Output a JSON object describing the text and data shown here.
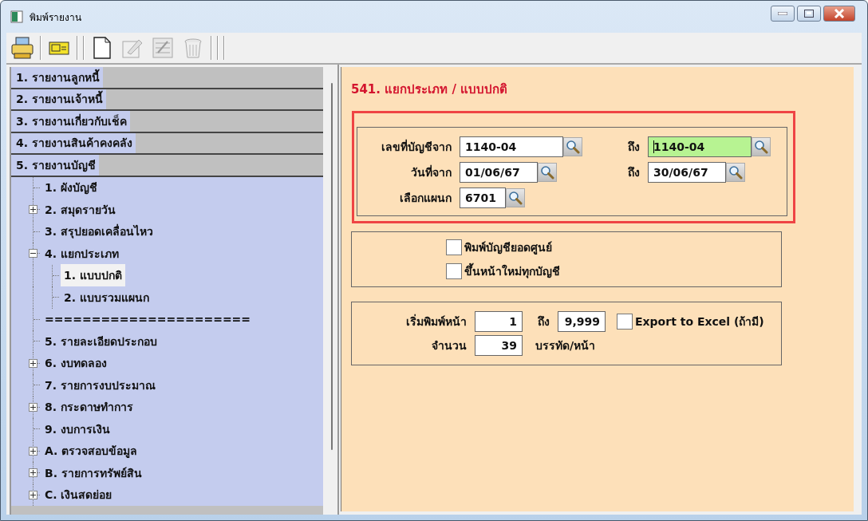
{
  "window": {
    "title": "พิมพ์รายงาน"
  },
  "toolbar": [
    {
      "kind": "printer",
      "disabled": false
    },
    {
      "kind": "card",
      "disabled": false
    },
    {
      "kind": "page",
      "disabled": false
    },
    {
      "kind": "edit",
      "disabled": true
    },
    {
      "kind": "form",
      "disabled": true
    },
    {
      "kind": "trash",
      "disabled": true
    }
  ],
  "sections": [
    {
      "label": "1. รายงานลูกหนี้"
    },
    {
      "label": "2. รายงานเจ้าหนี้"
    },
    {
      "label": "3. รายงานเกี่ยวกับเช็ค"
    },
    {
      "label": "4. รายงานสินค้าคงคลัง"
    },
    {
      "label": "5. รายงานบัญชี",
      "children": [
        {
          "label": "1. ผังบัญชี",
          "kind": "leaf",
          "selected": false
        },
        {
          "label": "2. สมุดรายวัน",
          "kind": "folder",
          "expanded": false,
          "selected": false
        },
        {
          "label": "3. สรุปยอดเคลื่อนไหว",
          "kind": "leaf",
          "selected": false
        },
        {
          "label": "4. แยกประเภท",
          "kind": "folder",
          "expanded": true,
          "selected": false,
          "children": [
            {
              "label": "1. แบบปกติ",
              "kind": "leaf",
              "selected": true
            },
            {
              "label": "2. แบบรวมแผนก",
              "kind": "leaf",
              "selected": false
            }
          ]
        },
        {
          "label": "======================",
          "kind": "leaf",
          "selected": false
        },
        {
          "label": "5. รายละเอียดประกอบ",
          "kind": "leaf",
          "selected": false
        },
        {
          "label": "6. งบทดลอง",
          "kind": "folder",
          "expanded": false,
          "selected": false
        },
        {
          "label": "7. รายการงบประมาณ",
          "kind": "leaf",
          "selected": false
        },
        {
          "label": "8. กระดาษทำการ",
          "kind": "folder",
          "expanded": false,
          "selected": false
        },
        {
          "label": "9. งบการเงิน",
          "kind": "leaf",
          "selected": false
        },
        {
          "label": "A. ตรวจสอบข้อมูล",
          "kind": "folder",
          "expanded": false,
          "selected": false
        },
        {
          "label": "B. รายการทรัพย์สิน",
          "kind": "folder",
          "expanded": false,
          "selected": false
        },
        {
          "label": "C. เงินสดย่อย",
          "kind": "folder",
          "expanded": false,
          "selected": false
        }
      ]
    }
  ],
  "form": {
    "title": "541. แยกประเภท / แบบปกติ",
    "filters": {
      "highlighted": true,
      "rows": [
        {
          "label": "เลขที่บัญชีจาก",
          "from": {
            "value": "1140-04",
            "focused": false
          },
          "to_label": "ถึง",
          "to": {
            "value": "1140-04",
            "focused": true
          }
        },
        {
          "label": "วันที่จาก",
          "from": {
            "value": "01/06/67",
            "focused": false
          },
          "to_label": "ถึง",
          "to": {
            "value": "30/06/67",
            "focused": false
          }
        },
        {
          "label": "เลือกแผนก",
          "from": {
            "value": "6701",
            "focused": false
          }
        }
      ]
    },
    "options": [
      {
        "label": "พิมพ์บัญชียอดศูนย์",
        "checked": false
      },
      {
        "label": "ขึ้นหน้าใหม่ทุกบัญชี",
        "checked": false
      }
    ],
    "pages": {
      "start_label": "เริ่มพิมพ์หน้า",
      "start": "1",
      "to_label": "ถึง",
      "end": "9,999",
      "export": {
        "label": "Export to Excel (ถ้ามี)",
        "checked": false
      },
      "count_label": "จำนวน",
      "count": "39",
      "unit": "บรรทัด/หน้า"
    }
  }
}
